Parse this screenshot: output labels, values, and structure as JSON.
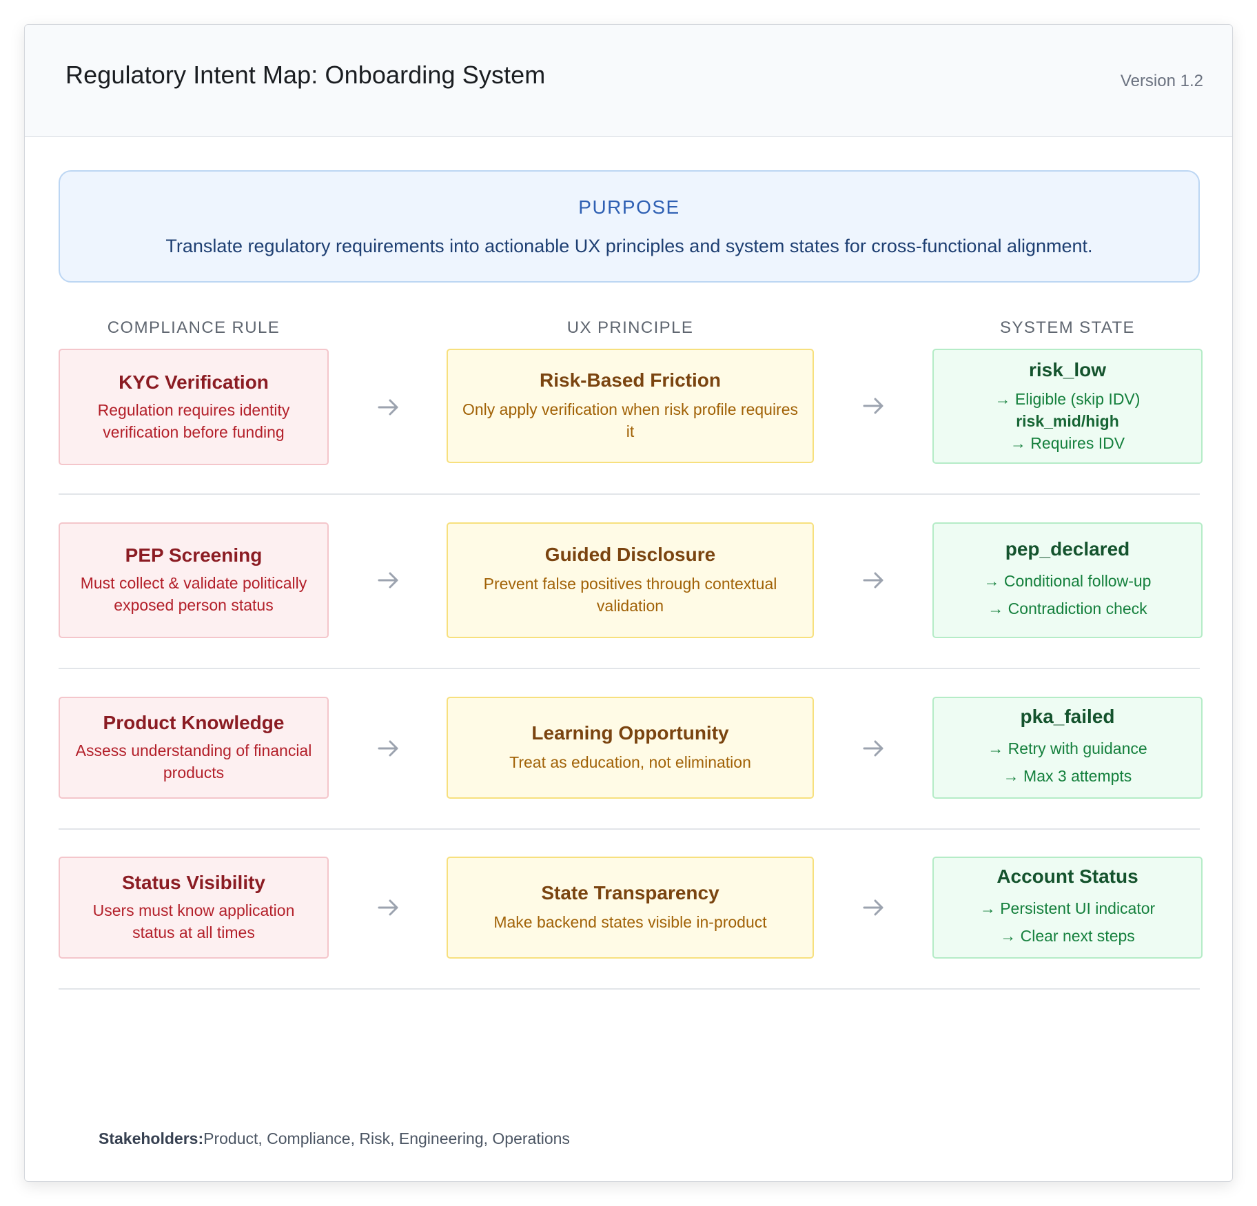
{
  "header": {
    "title": "Regulatory Intent Map: Onboarding System",
    "version": "Version 1.2"
  },
  "purpose": {
    "label": "PURPOSE",
    "text": "Translate regulatory requirements into actionable UX principles and system states for cross-functional alignment."
  },
  "columns": {
    "rule": "COMPLIANCE RULE",
    "ux": "UX PRINCIPLE",
    "state": "SYSTEM STATE"
  },
  "rows": [
    {
      "rule_title": "KYC Verification",
      "rule_desc": "Regulation requires identity verification before funding",
      "ux_title": "Risk-Based Friction",
      "ux_desc": "Only apply verification when risk profile requires it",
      "state_title": "risk_low",
      "state_lines": [
        "→ Eligible (skip IDV)",
        "risk_mid/high",
        "→ Requires IDV"
      ]
    },
    {
      "rule_title": "PEP Screening",
      "rule_desc": "Must collect & validate politically exposed person status",
      "ux_title": "Guided Disclosure",
      "ux_desc": "Prevent false positives through contextual validation",
      "state_title": "pep_declared",
      "state_lines": [
        "→ Conditional follow-up",
        "→ Contradiction check"
      ]
    },
    {
      "rule_title": "Product Knowledge",
      "rule_desc": "Assess understanding of financial products",
      "ux_title": "Learning Opportunity",
      "ux_desc": "Treat as education, not elimination",
      "state_title": "pka_failed",
      "state_lines": [
        "→ Retry with guidance",
        "→ Max 3 attempts"
      ]
    },
    {
      "rule_title": "Status Visibility",
      "rule_desc": "Users must know application status at all times",
      "ux_title": "State Transparency",
      "ux_desc": "Make backend states visible in-product",
      "state_title": "Account Status",
      "state_lines": [
        "→ Persistent UI indicator",
        "→ Clear next steps"
      ]
    }
  ],
  "footer": {
    "label": "Stakeholders:",
    "value": "Product, Compliance, Risk, Engineering, Operations"
  },
  "colors": {
    "rule_bg": "#fdf0f1",
    "ux_bg": "#fffbe6",
    "state_bg": "#eefcf3",
    "purpose_bg": "#eef5fe",
    "arrow": "#9ca3af"
  },
  "icons": {
    "flow_arrow": "arrow-right-icon"
  }
}
